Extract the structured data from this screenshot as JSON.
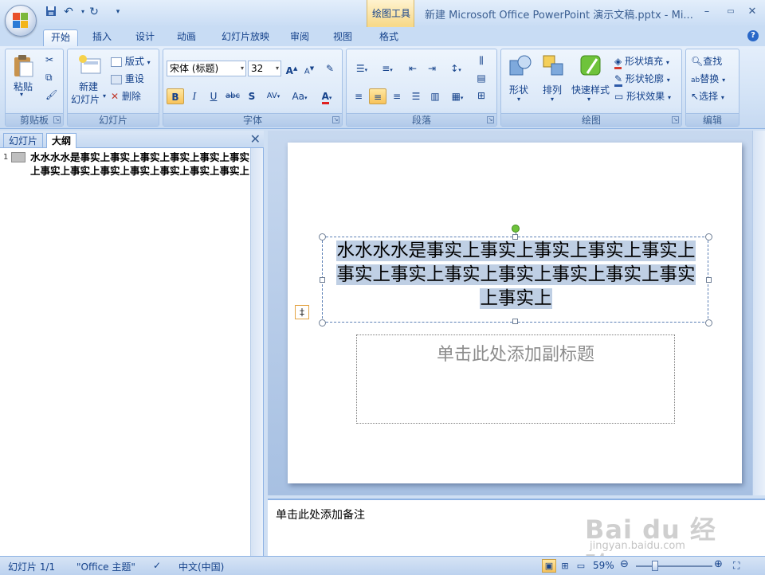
{
  "titlebar": {
    "title": "新建 Microsoft Office PowerPoint 演示文稿.pptx - Mi...",
    "context_tools_label": "绘图工具",
    "quick_access": [
      "save-icon",
      "undo-icon",
      "redo-icon",
      "customize-icon"
    ]
  },
  "tabs": [
    {
      "label": "开始",
      "active": true
    },
    {
      "label": "插入"
    },
    {
      "label": "设计"
    },
    {
      "label": "动画"
    },
    {
      "label": "幻灯片放映"
    },
    {
      "label": "审阅"
    },
    {
      "label": "视图"
    },
    {
      "label": "格式"
    }
  ],
  "ribbon": {
    "clipboard": {
      "label": "剪贴板",
      "paste": "粘贴"
    },
    "slides": {
      "label": "幻灯片",
      "new_slide_line1": "新建",
      "new_slide_line2": "幻灯片",
      "layout": "版式",
      "reset": "重设",
      "delete": "删除"
    },
    "font": {
      "label": "字体",
      "font_name": "宋体 (标题)",
      "font_size": "32",
      "bold": "B",
      "italic": "I",
      "underline": "U",
      "strike": "abc",
      "shadow": "S",
      "spacing": "AV",
      "case": "Aa",
      "color": "A"
    },
    "paragraph": {
      "label": "段落"
    },
    "drawing": {
      "label": "绘图",
      "shapes": "形状",
      "arrange": "排列",
      "quick_styles": "快速样式",
      "fill": "形状填充",
      "outline": "形状轮廓",
      "effects": "形状效果"
    },
    "editing": {
      "label": "编辑",
      "find": "查找",
      "replace": "替换",
      "select": "选择"
    }
  },
  "left_pane": {
    "tab_slides": "幻灯片",
    "tab_outline": "大纲",
    "slide_number": "1",
    "outline_text": "水水水水是事实上事实上事实上事实上事实上事实上事实上事实上事实上事实上事实上事实上事实上"
  },
  "slide": {
    "title_text": "水水水水是事实上事实上事实上事实上事实上事实上事实上事实上事实上事实上事实上事实上事实上",
    "subtitle_placeholder": "单击此处添加副标题"
  },
  "notes": {
    "placeholder": "单击此处添加备注",
    "watermark_logo": "Bai du 经验",
    "watermark_url": "jingyan.baidu.com"
  },
  "status": {
    "slide_info": "幻灯片 1/1",
    "theme": "\"Office 主题\"",
    "language": "中文(中国)",
    "zoom": "59%",
    "zoom_level": 0.59
  },
  "colors": {
    "accent": "#15428b",
    "ribbon_bg": "#d3e3f6",
    "selection": "#bfcfe4",
    "rotate_handle": "#6ec33b"
  }
}
